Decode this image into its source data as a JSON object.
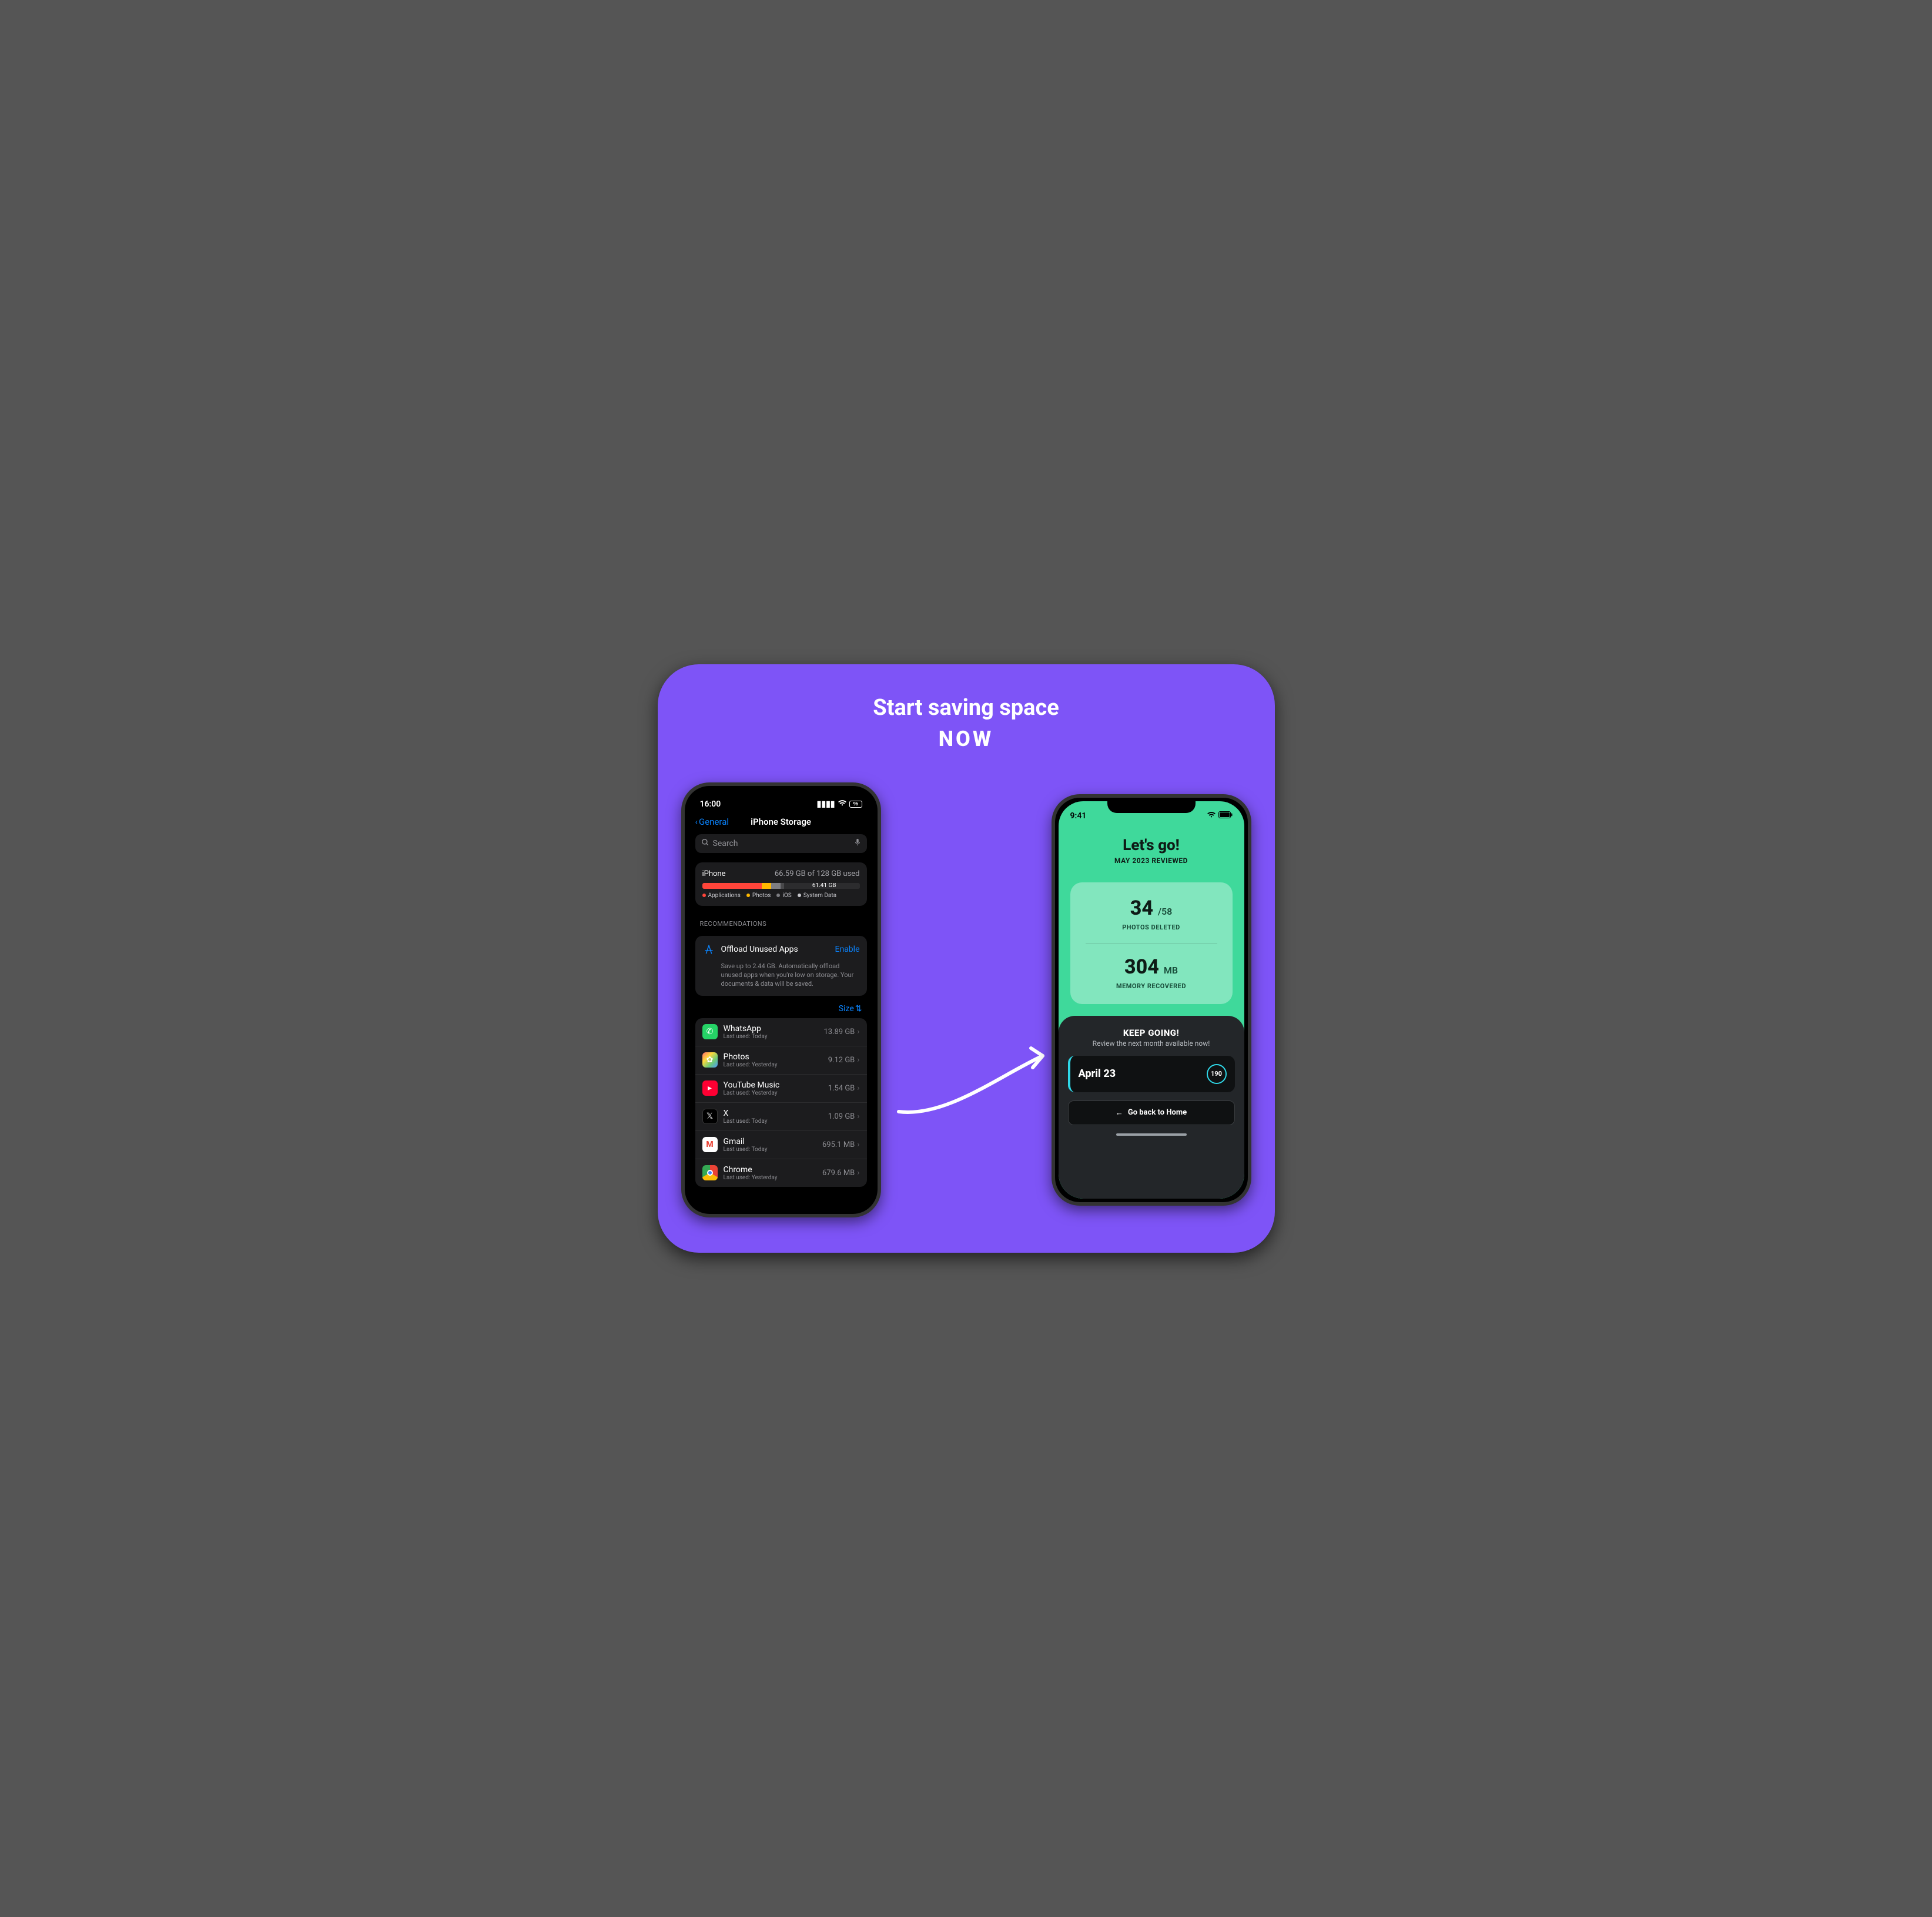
{
  "headline": {
    "line1": "Start saving space",
    "line2": "NOW"
  },
  "left": {
    "status": {
      "time": "16:00",
      "battery": "96"
    },
    "nav": {
      "back": "General",
      "title": "iPhone Storage"
    },
    "search": {
      "placeholder": "Search"
    },
    "storage": {
      "device": "iPhone",
      "used_text": "66.59 GB of 128 GB used",
      "free_text": "61.41 GB",
      "legend": [
        {
          "label": "Applications",
          "color": "#ff453a"
        },
        {
          "label": "Photos",
          "color": "#ffb800"
        },
        {
          "label": "iOS",
          "color": "#7d7d82"
        },
        {
          "label": "System Data",
          "color": "#c7c7cc"
        }
      ]
    },
    "recommendations": {
      "header": "RECOMMENDATIONS",
      "title": "Offload Unused Apps",
      "action": "Enable",
      "desc": "Save up to 2.44 GB. Automatically offload unused apps when you're low on storage. Your documents & data will be saved."
    },
    "sort": "Size",
    "apps": [
      {
        "name": "WhatsApp",
        "sub": "Last used: Today",
        "size": "13.89 GB",
        "bg": "#25D366",
        "glyph": "✆"
      },
      {
        "name": "Photos",
        "sub": "Last used: Yesterday",
        "size": "9.12 GB",
        "bg": "linear-gradient(135deg,#ff6b6b,#ffd93d,#6bcB77,#4d96ff)",
        "glyph": "✿"
      },
      {
        "name": "YouTube Music",
        "sub": "Last used: Yesterday",
        "size": "1.54 GB",
        "bg": "#ff0033",
        "glyph": "▸"
      },
      {
        "name": "X",
        "sub": "Last used: Today",
        "size": "1.09 GB",
        "bg": "#000",
        "glyph": "𝕏"
      },
      {
        "name": "Gmail",
        "sub": "Last used: Today",
        "size": "695.1 MB",
        "bg": "#fff",
        "glyph": "M"
      },
      {
        "name": "Chrome",
        "sub": "Last used: Yesterday",
        "size": "679.6 MB",
        "bg": "#fff",
        "glyph": "◉"
      }
    ]
  },
  "right": {
    "status": {
      "time": "9:41"
    },
    "hero": {
      "title": "Let's go!",
      "subtitle": "MAY 2023 REVIEWED"
    },
    "stats": {
      "deleted_count": "34",
      "deleted_total": "/58",
      "deleted_label": "PHOTOS DELETED",
      "memory_value": "304",
      "memory_unit": "MB",
      "memory_label": "MEMORY RECOVERED"
    },
    "keep": {
      "title": "KEEP GOING!",
      "subtitle": "Review the next month available now!",
      "month": "April 23",
      "count": "190",
      "home": "Go back to Home"
    }
  }
}
